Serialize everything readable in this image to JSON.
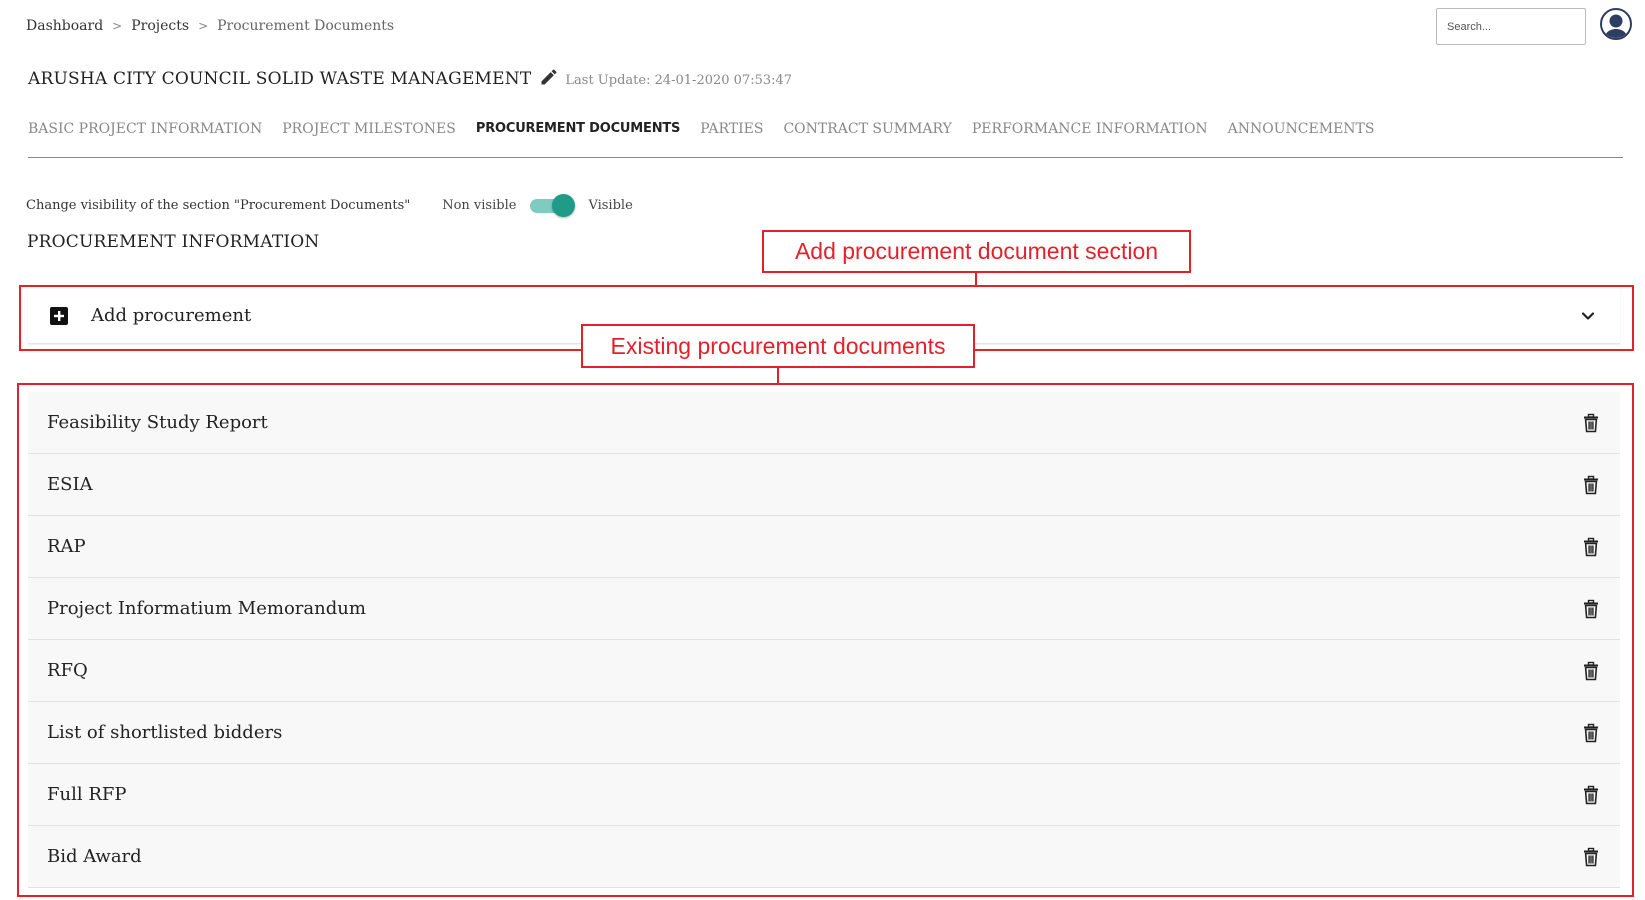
{
  "breadcrumb": {
    "items": [
      "Dashboard",
      "Projects",
      "Procurement Documents"
    ],
    "separator": ">"
  },
  "search": {
    "placeholder": "Search..."
  },
  "project": {
    "title": "ARUSHA CITY COUNCIL SOLID WASTE MANAGEMENT",
    "last_update": "Last Update: 24-01-2020 07:53:47"
  },
  "tabs": [
    {
      "label": "BASIC PROJECT INFORMATION",
      "active": false
    },
    {
      "label": "PROJECT MILESTONES",
      "active": false
    },
    {
      "label": "PROCUREMENT DOCUMENTS",
      "active": true
    },
    {
      "label": "PARTIES",
      "active": false
    },
    {
      "label": "CONTRACT SUMMARY",
      "active": false
    },
    {
      "label": "PERFORMANCE INFORMATION",
      "active": false
    },
    {
      "label": "ANNOUNCEMENTS",
      "active": false
    }
  ],
  "visibility": {
    "label": "Change visibility of the section \"Procurement Documents\"",
    "off_label": "Non visible",
    "on_label": "Visible",
    "state": "on"
  },
  "section_heading": "PROCUREMENT INFORMATION",
  "add_procurement": {
    "label": "Add procurement",
    "icon": "plus-square-icon",
    "expand_icon": "chevron-down-icon"
  },
  "documents": [
    {
      "name": "Feasibility Study Report"
    },
    {
      "name": "ESIA"
    },
    {
      "name": "RAP"
    },
    {
      "name": "Project Informatium Memorandum"
    },
    {
      "name": "RFQ"
    },
    {
      "name": "List of shortlisted bidders"
    },
    {
      "name": "Full RFP"
    },
    {
      "name": "Bid Award"
    }
  ],
  "annotations": {
    "add_section": "Add procurement document section",
    "existing_docs": "Existing procurement documents"
  },
  "colors": {
    "accent_teal": "#1f9b88",
    "annotation_red": "#e3212b"
  }
}
